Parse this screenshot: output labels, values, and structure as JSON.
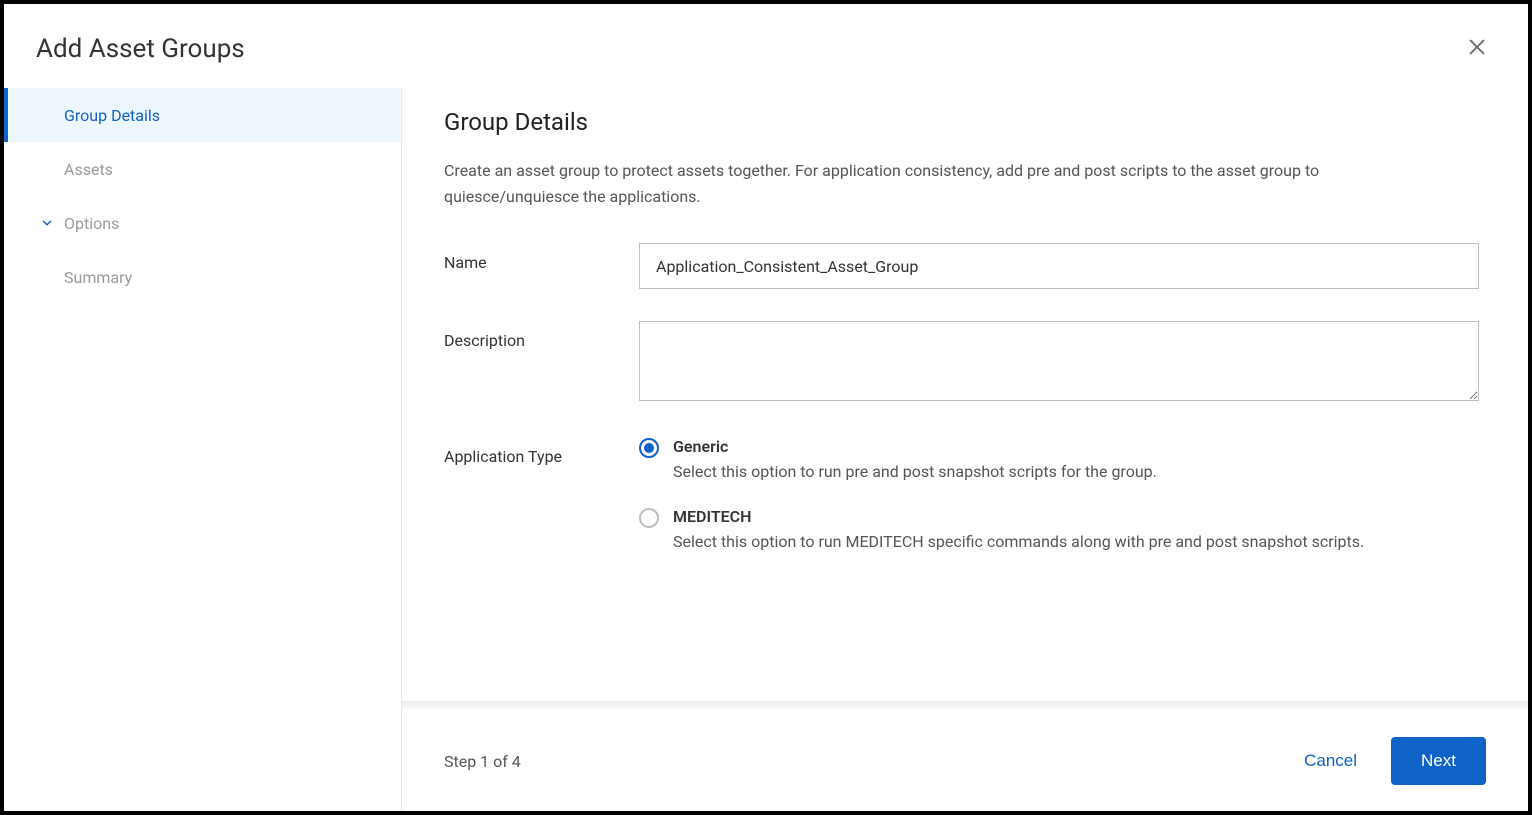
{
  "modal": {
    "title": "Add Asset Groups"
  },
  "sidebar": {
    "items": [
      {
        "label": "Group Details"
      },
      {
        "label": "Assets"
      },
      {
        "label": "Options"
      },
      {
        "label": "Summary"
      }
    ]
  },
  "main": {
    "heading": "Group Details",
    "intro": "Create an asset group to protect assets together. For application consistency, add pre and post scripts to the asset group to quiesce/unquiesce the applications.",
    "form": {
      "name_label": "Name",
      "name_value": "Application_Consistent_Asset_Group",
      "description_label": "Description",
      "description_value": "",
      "apptype_label": "Application Type",
      "apptype_options": [
        {
          "title": "Generic",
          "desc": "Select this option to run pre and post snapshot scripts for the group.",
          "checked": true
        },
        {
          "title": "MEDITECH",
          "desc": "Select this option to run MEDITECH specific commands along with pre and post snapshot scripts.",
          "checked": false
        }
      ]
    }
  },
  "footer": {
    "step": "Step 1 of 4",
    "cancel": "Cancel",
    "next": "Next"
  }
}
